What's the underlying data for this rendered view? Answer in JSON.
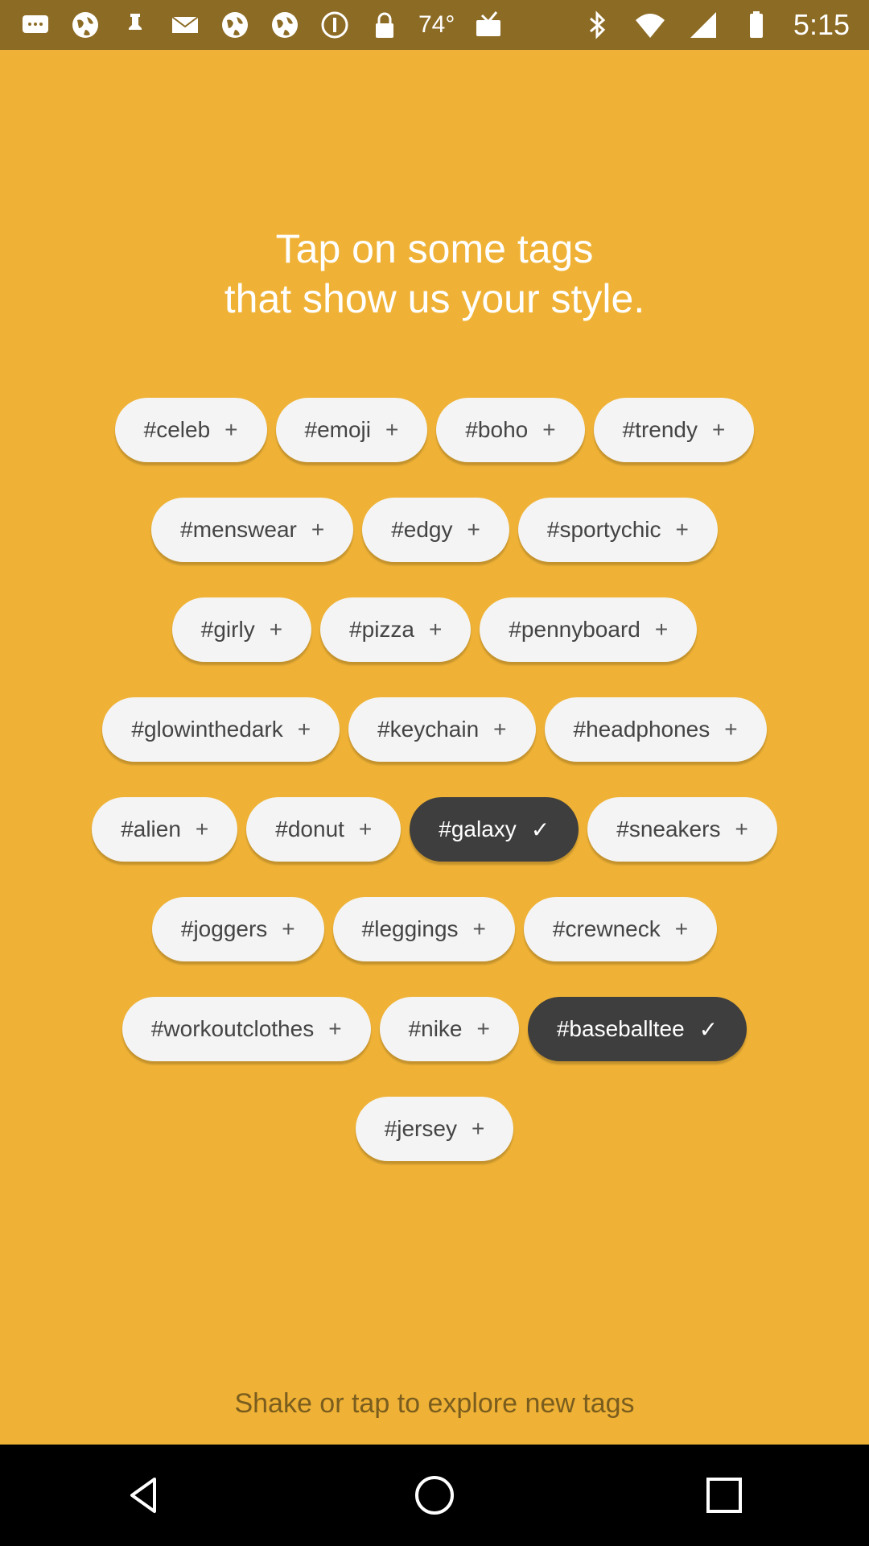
{
  "status_bar": {
    "icons_left": [
      "message-icon",
      "globe-icon",
      "globe-icon",
      "pin-icon",
      "mail-icon",
      "globe-icon",
      "globe-icon",
      "info-icon",
      "lock-icon"
    ],
    "temperature": "74°",
    "bluetooth": "bluetooth-icon",
    "wifi": "wifi-icon",
    "signal": "signal-icon",
    "battery": "battery-icon",
    "time": "5:15"
  },
  "headline": {
    "line1": "Tap on some tags",
    "line2": "that show us your style."
  },
  "tags": {
    "plus_mark": "+",
    "check_mark": "✓",
    "rows": [
      [
        {
          "label": "#celeb",
          "selected": false
        },
        {
          "label": "#emoji",
          "selected": false
        },
        {
          "label": "#boho",
          "selected": false
        },
        {
          "label": "#trendy",
          "selected": false
        }
      ],
      [
        {
          "label": "#menswear",
          "selected": false
        },
        {
          "label": "#edgy",
          "selected": false
        },
        {
          "label": "#sportychic",
          "selected": false
        }
      ],
      [
        {
          "label": "#girly",
          "selected": false
        },
        {
          "label": "#pizza",
          "selected": false
        },
        {
          "label": "#pennyboard",
          "selected": false
        }
      ],
      [
        {
          "label": "#glowinthedark",
          "selected": false
        },
        {
          "label": "#keychain",
          "selected": false
        },
        {
          "label": "#headphones",
          "selected": false
        }
      ],
      [
        {
          "label": "#alien",
          "selected": false
        },
        {
          "label": "#donut",
          "selected": false
        },
        {
          "label": "#galaxy",
          "selected": true
        },
        {
          "label": "#sneakers",
          "selected": false
        }
      ],
      [
        {
          "label": "#joggers",
          "selected": false
        },
        {
          "label": "#leggings",
          "selected": false
        },
        {
          "label": "#crewneck",
          "selected": false
        }
      ],
      [
        {
          "label": "#workoutclothes",
          "selected": false
        },
        {
          "label": "#nike",
          "selected": false
        },
        {
          "label": "#baseballtee",
          "selected": true
        }
      ],
      [
        {
          "label": "#jersey",
          "selected": false
        }
      ]
    ]
  },
  "footer": {
    "hint": "Shake or tap to explore new tags"
  },
  "nav_bar": {
    "back": "back-icon",
    "home": "home-icon",
    "recents": "recents-icon"
  },
  "colors": {
    "background": "#EFB236",
    "status_bar": "#8C6B24",
    "tag_bg": "#F4F4F4",
    "tag_selected_bg": "#3E3E3E",
    "footer_text": "#7A5D1E"
  }
}
